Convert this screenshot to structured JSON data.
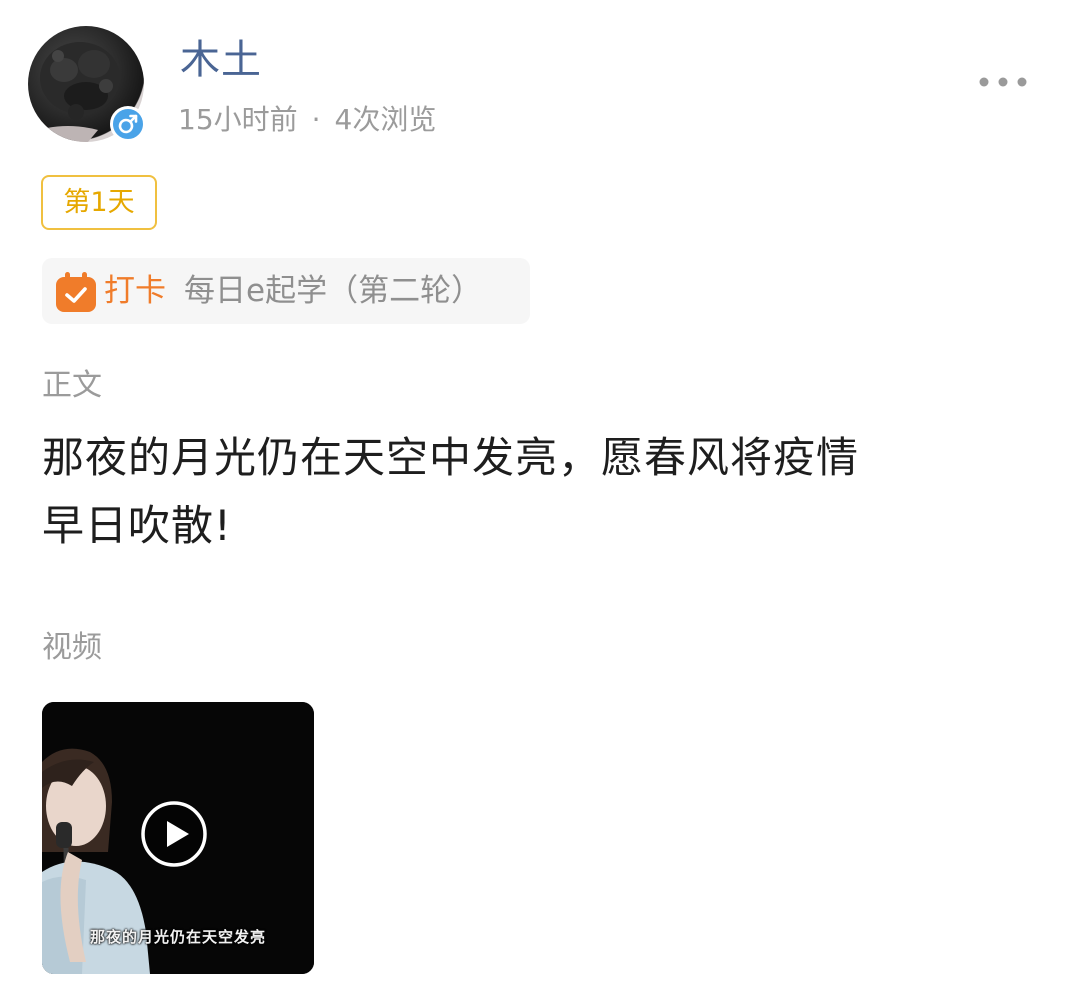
{
  "post": {
    "author": {
      "name": "木土",
      "avatar_icon": "avatar-photo",
      "gender_icon": "male-icon"
    },
    "time_ago": "15小时前",
    "separator": "·",
    "views": "4次浏览",
    "more_icon": "more-horizontal-icon",
    "day_tag": "第1天",
    "checkin": {
      "icon": "calendar-check-icon",
      "label": "打卡",
      "activity": "每日e起学（第二轮）"
    },
    "body_section_label": "正文",
    "body_lines": [
      "那夜的月光仍在天空中发亮，愿春风将疫情",
      "早日吹散!"
    ],
    "video_section_label": "视频",
    "video": {
      "play_icon": "play-circle-icon",
      "subtitle": "那夜的月光仍在天空发亮"
    }
  },
  "colors": {
    "username": "#4a6594",
    "meta_gray": "#9b9b9b",
    "day_tag_border": "#f0c040",
    "day_tag_text": "#e6a800",
    "checkin_orange": "#f07c2a",
    "checkin_bg": "#f6f6f6",
    "gender_badge": "#4aa3e8"
  }
}
